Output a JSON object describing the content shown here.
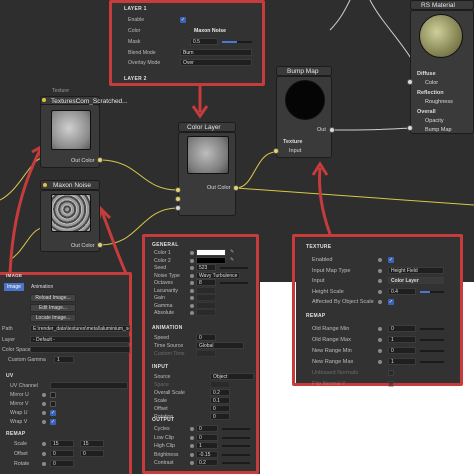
{
  "colors": {
    "accent": "#c63b3b",
    "wire_yellow": "#d9c84a",
    "wire_white": "#cfcfcf",
    "panel_bg": "#323232",
    "node_bg": "#3a3a3a",
    "checkbox_blue": "#3a63b8"
  },
  "layer_panel": {
    "section1": "LAYER 1",
    "section2": "LAYER 2",
    "rows": [
      {
        "label": "Enable",
        "value": ""
      },
      {
        "label": "Color",
        "value": "Maxon Noise"
      },
      {
        "label": "Mask",
        "value": "0.5"
      },
      {
        "label": "Blend Mode",
        "value": "Burn"
      },
      {
        "label": "Overlay Mode",
        "value": "Over"
      }
    ],
    "mask_level": 0.5
  },
  "nodes": {
    "texture_caption": "Texture",
    "texture_title": "TexturesCom_Scratched...",
    "texture_out": "Out Color",
    "noise_title": "Maxon Noise",
    "noise_out": "Out Color",
    "color_layer_title": "Color Layer",
    "color_layer_out": "Out Color",
    "bump_title": "Bump Map",
    "bump_out": "Out",
    "bump_in_section": "Texture",
    "bump_in_input": "Input",
    "rs_title": "RS Material",
    "rs_rows": [
      "Diffuse",
      "Color",
      "Reflection",
      "Roughness",
      "Overall",
      "Opacity",
      "Bump Map"
    ]
  },
  "noise_panel": {
    "general": "GENERAL",
    "rows": [
      {
        "label": "Color 1",
        "value": ""
      },
      {
        "label": "Color 2",
        "value": ""
      },
      {
        "label": "Seed",
        "value": "523"
      },
      {
        "label": "Noise Type",
        "value": "Wavy Turbulence"
      },
      {
        "label": "Octaves",
        "value": "8"
      },
      {
        "label": "Lacunarity",
        "value": ""
      },
      {
        "label": "Gain",
        "value": ""
      },
      {
        "label": "Gamma",
        "value": ""
      },
      {
        "label": "Absolute",
        "value": ""
      }
    ],
    "animation": "ANIMATION",
    "anim_rows": [
      {
        "label": "Speed",
        "value": "0"
      },
      {
        "label": "Time Source",
        "value": "Global"
      },
      {
        "label": "Custom Time",
        "value": ""
      }
    ],
    "input": "INPUT",
    "input_rows": [
      {
        "label": "Source",
        "value": "Object"
      },
      {
        "label": "Space",
        "value": ""
      },
      {
        "label": "Overall Scale",
        "value": "0.2"
      },
      {
        "label": "Scale",
        "value": "0.1"
      },
      {
        "label": "Offset",
        "value": "0"
      },
      {
        "label": "Rotation",
        "value": "0"
      }
    ],
    "output": "OUTPUT",
    "output_rows": [
      {
        "label": "Cycles",
        "value": "0"
      },
      {
        "label": "Low Clip",
        "value": "0"
      },
      {
        "label": "High Clip",
        "value": "1"
      },
      {
        "label": "Brightness",
        "value": "-0.15"
      },
      {
        "label": "Contrast",
        "value": "0.2"
      }
    ]
  },
  "texture_panel": {
    "header": "TEXTURE",
    "rows": [
      {
        "label": "Enabled",
        "value": ""
      },
      {
        "label": "Input Map Type",
        "value": "Height Field"
      },
      {
        "label": "Input",
        "value": "Color Layer"
      },
      {
        "label": "Height Scale",
        "value": "0.4"
      },
      {
        "label": "Affected By Object Scale",
        "value": ""
      }
    ],
    "remap": "REMAP",
    "remap_rows": [
      {
        "label": "Old Range Min",
        "value": "0"
      },
      {
        "label": "Old Range Max",
        "value": "1"
      },
      {
        "label": "New Range Min",
        "value": "0"
      },
      {
        "label": "New Range Max",
        "value": "1"
      },
      {
        "label": "Unbiased Normals",
        "value": ""
      },
      {
        "label": "Flip Normal Y",
        "value": ""
      }
    ],
    "height_scale_level": 0.4
  },
  "image_panel": {
    "header": "IMAGE",
    "tabs": [
      "Image",
      "Animation"
    ],
    "buttons": [
      "Reload Image...",
      "Edit Image...",
      "Locate Image..."
    ],
    "path_label": "Path",
    "path_value": "E:\\render_data\\textures\\metal\\aluminium_scr",
    "layer_label": "Layer",
    "layer_value": "- Default -",
    "color_space_label": "Color Space",
    "custom_gamma_label": "Custom Gamma",
    "custom_gamma_value": "1",
    "uv": "UV",
    "uv_channel_label": "UV Channel",
    "uv_checks": [
      "Mirror U",
      "Mirror V",
      "Wrap U",
      "Wrap V"
    ],
    "remap": "REMAP",
    "remap_rows": [
      {
        "label": "Scale",
        "v1": "15",
        "v2": "15"
      },
      {
        "label": "Offset",
        "v1": "0",
        "v2": "0"
      },
      {
        "label": "Rotate",
        "v1": "0",
        "v2": ""
      }
    ]
  }
}
